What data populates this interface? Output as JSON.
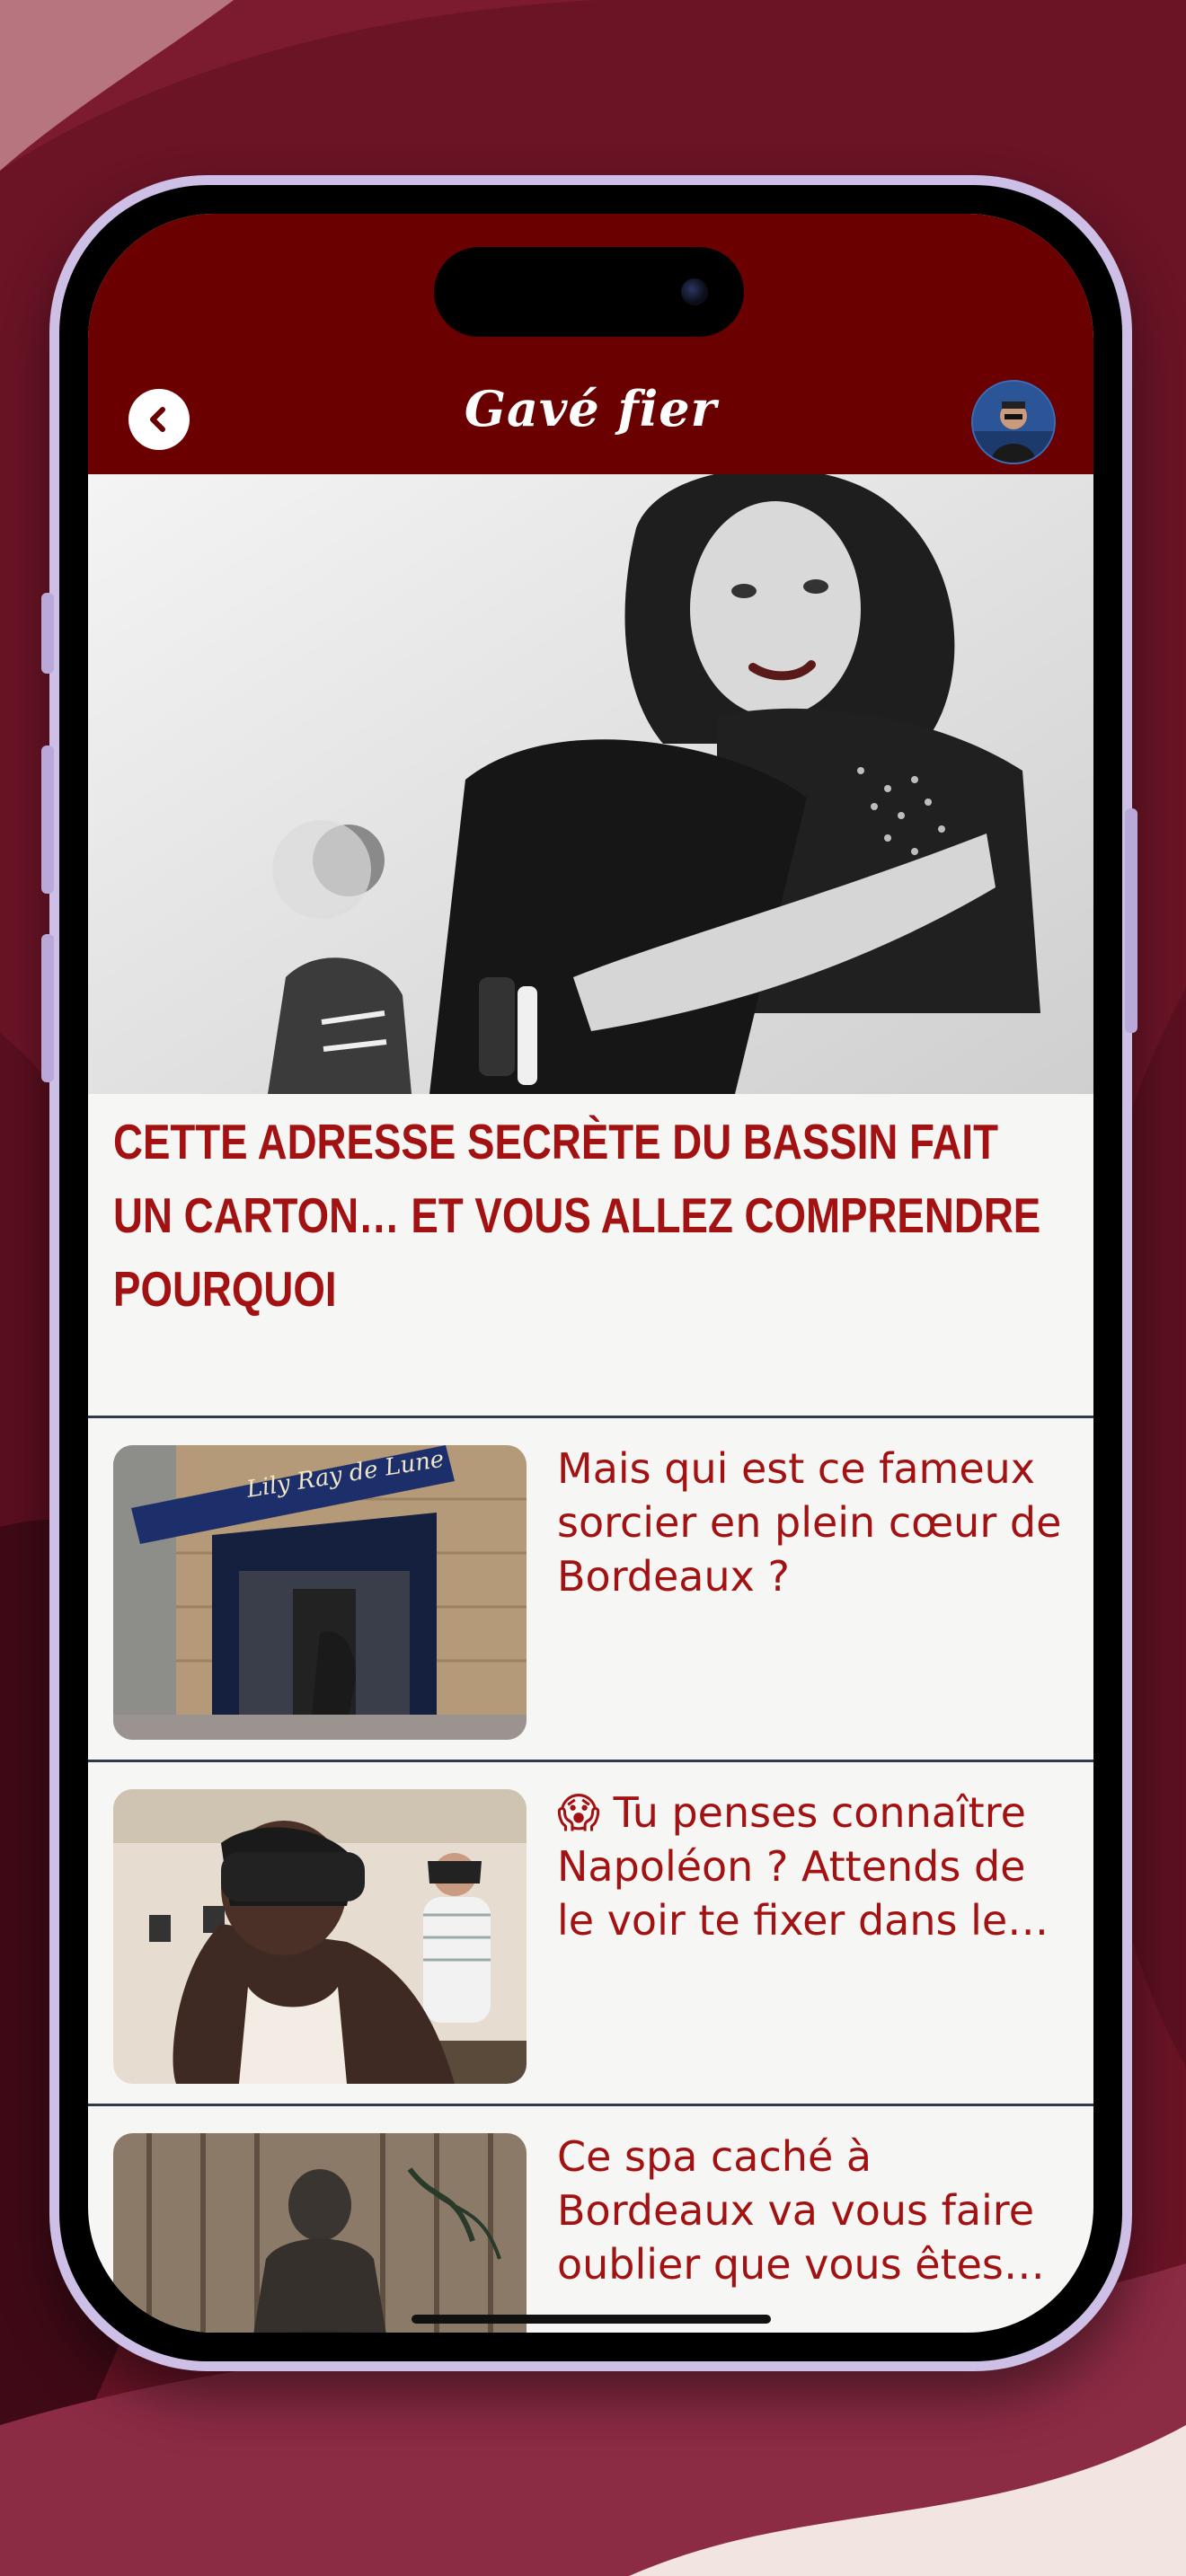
{
  "app": {
    "logo_text": "Gavé fier",
    "brand_color": "#6b0000",
    "title_color": "#a31212"
  },
  "header": {
    "back_icon": "chevron-left-icon",
    "avatar_icon": "user-avatar"
  },
  "hero": {
    "title": "Cette adresse secrète du Bassin fait un carton… et vous allez comprendre pourquoi"
  },
  "articles": [
    {
      "title": "Mais qui est ce fameux sorcier en plein cœur de Bordeaux ?",
      "shop_sign": "Lily Ray de Lune"
    },
    {
      "title": "😱 Tu penses connaître Napoléon ? Attends de le voir te fixer dans le…"
    },
    {
      "title": "Ce spa caché à Bordeaux va vous faire oublier que vous êtes…"
    }
  ]
}
